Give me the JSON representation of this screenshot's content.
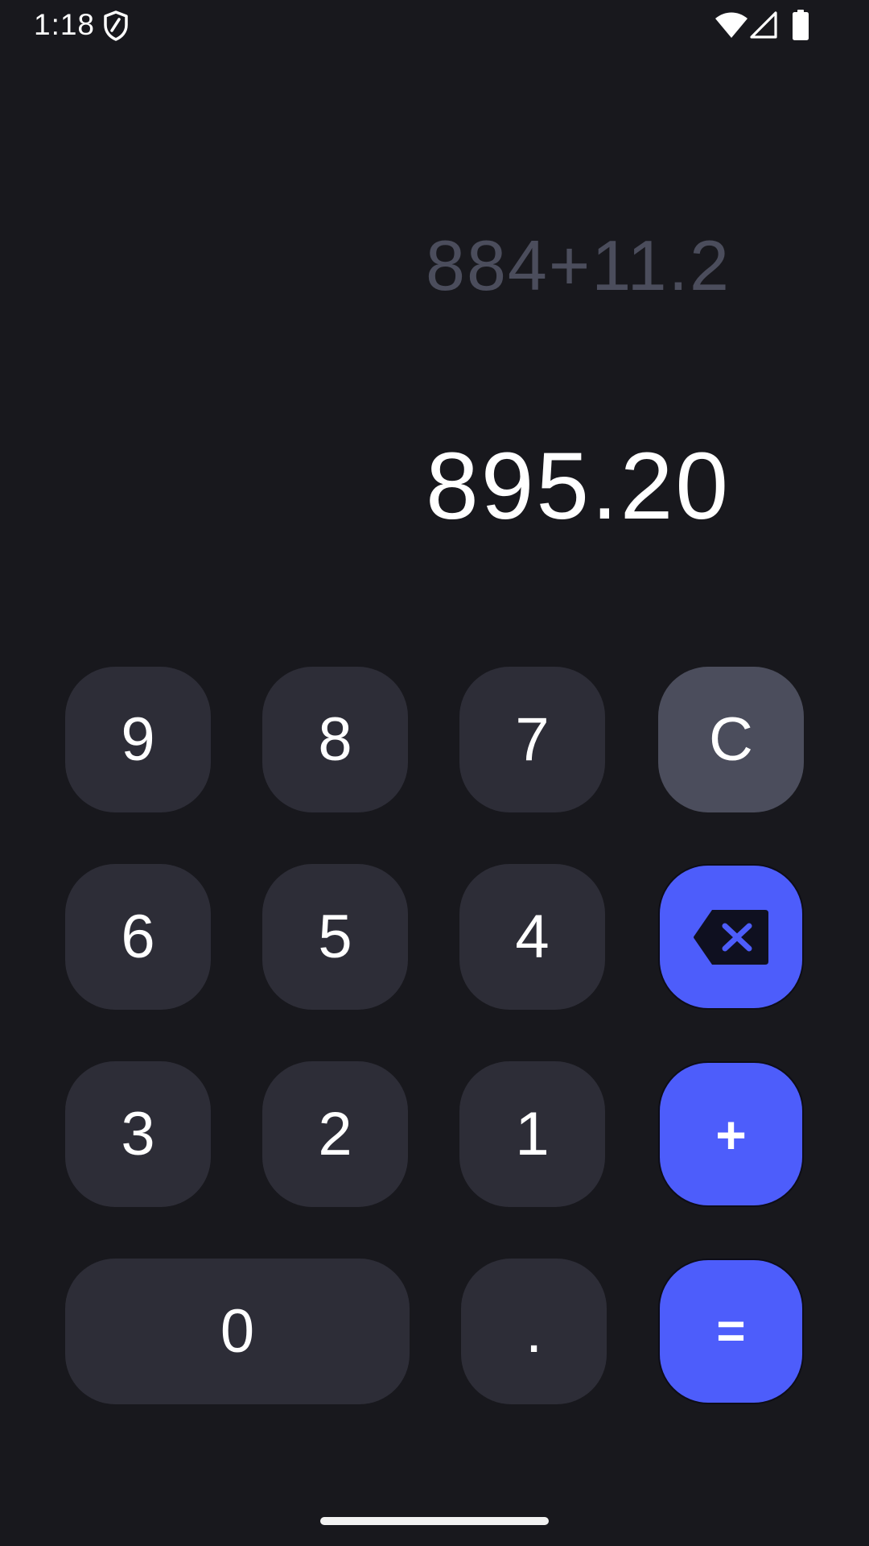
{
  "status_bar": {
    "time": "1:18",
    "icons": [
      "shield-icon",
      "wifi-icon",
      "signal-icon",
      "battery-icon"
    ]
  },
  "display": {
    "expression": "884+11.2",
    "result": "895.20"
  },
  "keypad": {
    "rows": [
      [
        "9",
        "8",
        "7",
        "C"
      ],
      [
        "6",
        "5",
        "4",
        "backspace-icon"
      ],
      [
        "3",
        "2",
        "1",
        "+"
      ],
      [
        "0",
        ".",
        "="
      ]
    ],
    "k9": "9",
    "k8": "8",
    "k7": "7",
    "clear": "C",
    "k6": "6",
    "k5": "5",
    "k4": "4",
    "k3": "3",
    "k2": "2",
    "k1": "1",
    "plus": "+",
    "k0": "0",
    "dot": ".",
    "equals": "="
  },
  "colors": {
    "background": "#18181d",
    "key": "#2d2d37",
    "key_clear": "#4b4d5c",
    "accent": "#4d5dfb",
    "expression_text": "#4b4d5c",
    "result_text": "#ffffff"
  }
}
